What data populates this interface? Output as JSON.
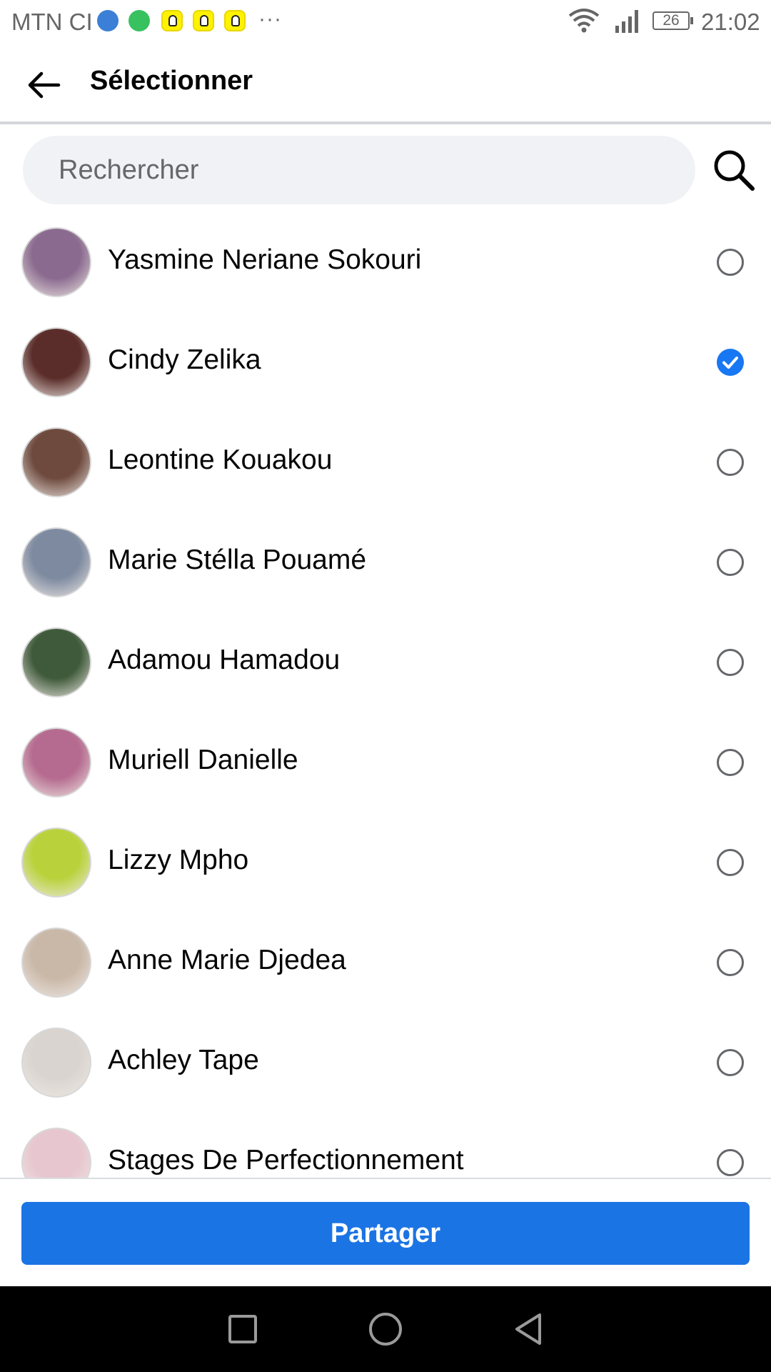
{
  "status_bar": {
    "carrier": "MTN CI",
    "more": "···",
    "battery": "26",
    "time": "21:02",
    "icons": [
      "globe-icon",
      "whatsapp-icon",
      "snapchat-icon",
      "snapchat-icon",
      "snapchat-icon",
      "wifi-icon",
      "signal-icon",
      "battery-icon"
    ]
  },
  "header": {
    "back_icon": "arrow-left-icon",
    "title": "Sélectionner"
  },
  "search": {
    "placeholder": "Rechercher",
    "value": "",
    "icon": "search-icon"
  },
  "contacts": [
    {
      "name": "Yasmine Neriane Sokouri",
      "selected": false,
      "avatar_color": "#8a6a8f"
    },
    {
      "name": "Cindy Zelika",
      "selected": true,
      "avatar_color": "#5a2d2a"
    },
    {
      "name": "Leontine Kouakou",
      "selected": false,
      "avatar_color": "#6e4a3e"
    },
    {
      "name": "Marie Stélla Pouamé",
      "selected": false,
      "avatar_color": "#7d8aa0"
    },
    {
      "name": "Adamou Hamadou",
      "selected": false,
      "avatar_color": "#3f5a3a"
    },
    {
      "name": "Muriell Danielle",
      "selected": false,
      "avatar_color": "#b56b8f"
    },
    {
      "name": "Lizzy Mpho",
      "selected": false,
      "avatar_color": "#b9d23c"
    },
    {
      "name": "Anne Marie Djedea",
      "selected": false,
      "avatar_color": "#c9b8a8"
    },
    {
      "name": "Achley Tape",
      "selected": false,
      "avatar_color": "#d9d4cf"
    },
    {
      "name": "Stages De Perfectionnement",
      "selected": false,
      "avatar_color": "#e7c6cf"
    }
  ],
  "footer": {
    "share_label": "Partager"
  },
  "colors": {
    "accent": "#1b74e4",
    "checked": "#1877f2",
    "search_bg": "#f0f2f5",
    "text": "#050505",
    "muted": "#65676b"
  },
  "nav_bar": [
    "recent-apps-icon",
    "home-icon",
    "back-icon"
  ]
}
